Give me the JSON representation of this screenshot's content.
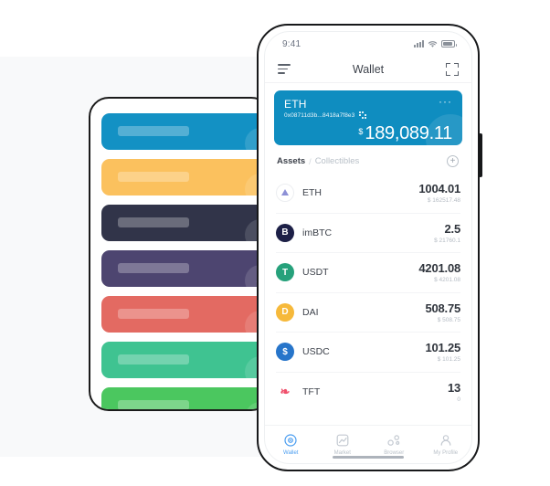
{
  "colors": {
    "card_blue": "#0f8dc0",
    "accent": "#4a9df0",
    "page_bg": "#ffffff",
    "panel_bg": "#f8f9fa"
  },
  "back_phone": {
    "name": "placeholder-token-cards",
    "cards": [
      {
        "color": "#1391c4",
        "watermark_icon": "ethereum-diamond-icon",
        "glyph": "♦"
      },
      {
        "color": "#fbc15e",
        "watermark_icon": "bitcoin-b-icon",
        "glyph": "B"
      },
      {
        "color": "#313449",
        "watermark_icon": "cosmos-atom-icon",
        "glyph": "⚛"
      },
      {
        "color": "#4d4570",
        "watermark_icon": "eos-drop-icon",
        "glyph": "◇"
      },
      {
        "color": "#e36a62",
        "watermark_icon": "tron-triangle-icon",
        "glyph": "△"
      },
      {
        "color": "#3fc391",
        "watermark_icon": "nano-n-icon",
        "glyph": "N"
      },
      {
        "color": "#4bc75f",
        "watermark_icon": "bitcoin-cash-b-icon",
        "glyph": "B"
      },
      {
        "color": "#2e7ef0",
        "watermark_icon": "litecoin-l-icon",
        "glyph": "L"
      }
    ]
  },
  "phone": {
    "status_bar": {
      "time": "9:41",
      "signal_icon": "cellular-signal-icon",
      "wifi_icon": "wifi-icon",
      "battery_icon": "battery-full-icon"
    },
    "navbar": {
      "menu_icon": "hamburger-menu-icon",
      "title": "Wallet",
      "scan_icon": "scan-qr-frame-icon"
    },
    "balance_card": {
      "symbol": "ETH",
      "address": "0x08711d3b...8418a7f8e3",
      "qr_icon": "qr-code-icon",
      "more_icon": "more-options-dots",
      "more_glyph": "···",
      "currency": "$",
      "amount": "189,089.11"
    },
    "asset_tabs": {
      "assets_label": "Assets",
      "separator": "/",
      "collectibles_label": "Collectibles",
      "add_icon": "add-plus-icon",
      "add_glyph": "+"
    },
    "assets": [
      {
        "symbol": "ETH",
        "icon": "ethereum-coin-icon",
        "glyph": "",
        "qty": "1004.01",
        "fiat": "$ 162517.48"
      },
      {
        "symbol": "imBTC",
        "icon": "imbtc-coin-icon",
        "glyph": "B",
        "qty": "2.5",
        "fiat": "$ 21760.1"
      },
      {
        "symbol": "USDT",
        "icon": "tether-coin-icon",
        "glyph": "T",
        "qty": "4201.08",
        "fiat": "$ 4201.08"
      },
      {
        "symbol": "DAI",
        "icon": "dai-coin-icon",
        "glyph": "D",
        "qty": "508.75",
        "fiat": "$ 508.75"
      },
      {
        "symbol": "USDC",
        "icon": "usdc-coin-icon",
        "glyph": "$",
        "qty": "101.25",
        "fiat": "$ 101.25"
      },
      {
        "symbol": "TFT",
        "icon": "tft-coin-icon",
        "glyph": "❧",
        "qty": "13",
        "fiat": "0"
      }
    ],
    "tabbar": [
      {
        "label": "Wallet",
        "icon": "wallet-target-icon",
        "active": true
      },
      {
        "label": "Market",
        "icon": "market-chart-icon",
        "active": false
      },
      {
        "label": "Browser",
        "icon": "browser-nodes-icon",
        "active": false
      },
      {
        "label": "My Profile",
        "icon": "user-profile-icon",
        "active": false
      }
    ]
  }
}
